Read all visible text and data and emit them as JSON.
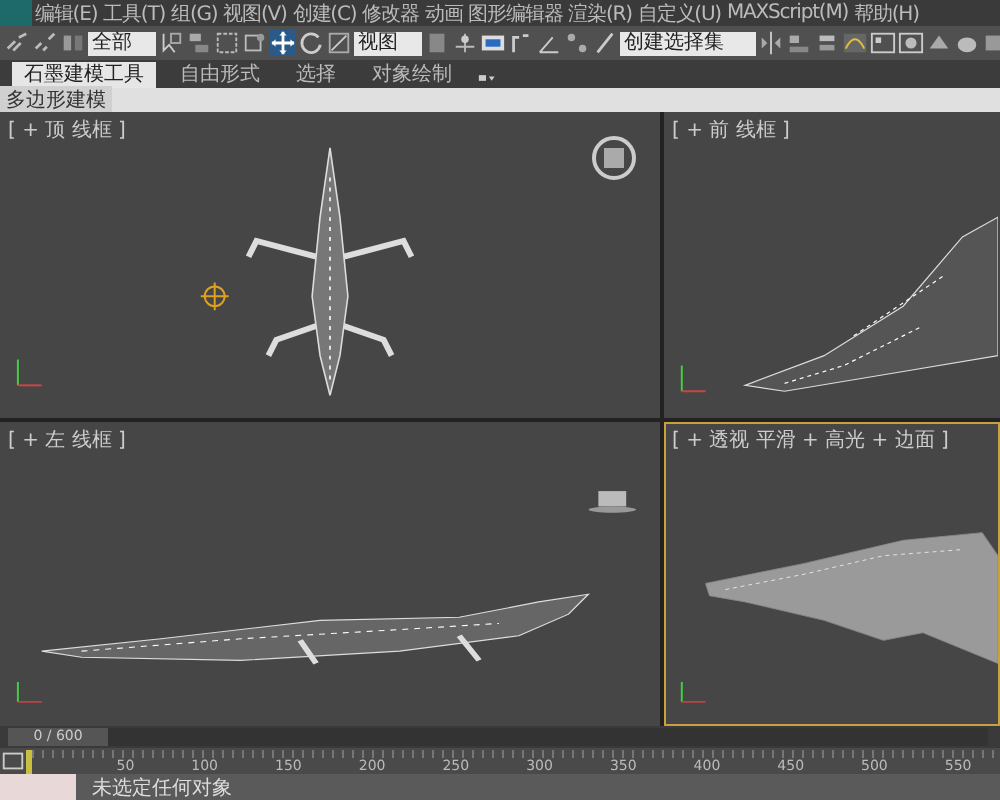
{
  "menu_bar": {
    "items": [
      "编辑(E)",
      "工具(T)",
      "组(G)",
      "视图(V)",
      "创建(C)",
      "修改器",
      "动画",
      "图形编辑器",
      "渲染(R)",
      "自定义(U)",
      "MAXScript(M)",
      "帮助(H)"
    ]
  },
  "toolbar": {
    "selection_filter": "全部",
    "reference_coordinate": "视图",
    "named_selection": "创建选择集"
  },
  "ribbon": {
    "tabs": [
      {
        "label": "石墨建模工具",
        "selected": true
      },
      {
        "label": "自由形式",
        "selected": false
      },
      {
        "label": "选择",
        "selected": false
      },
      {
        "label": "对象绘制",
        "selected": false
      }
    ],
    "panel_label": "多边形建模"
  },
  "viewports": [
    {
      "kind": "top",
      "label": "[ + 顶 线框 ]",
      "selected": false
    },
    {
      "kind": "front",
      "label": "[ + 前 线框 ]",
      "selected": false
    },
    {
      "kind": "left",
      "label": "[ + 左 线框 ]",
      "selected": false
    },
    {
      "kind": "perspective",
      "label": "[ + 透视 平滑 + 高光 + 边面 ]",
      "selected": true
    }
  ],
  "time_slider": {
    "frame": "0 / 600",
    "level": 0
  },
  "timeline": {
    "ticks": [
      "50",
      "100",
      "150",
      "200",
      "250",
      "300",
      "350",
      "400",
      "450",
      "500",
      "550"
    ]
  },
  "status_bar": {
    "message": "未选定任何对象"
  }
}
